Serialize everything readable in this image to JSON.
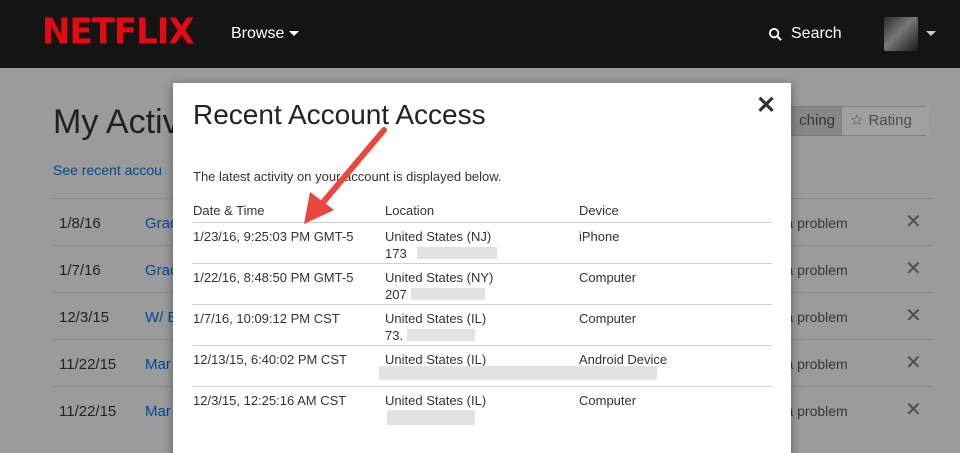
{
  "nav": {
    "logo": "NETFLIX",
    "browse_label": "Browse",
    "search_label": "Search"
  },
  "page": {
    "title": "My Activi",
    "see_recent_link": "See recent accou",
    "tabs": {
      "watching": "ching",
      "rating": "Rating"
    },
    "rows": [
      {
        "date": "1/8/16",
        "title": "Grac",
        "report": "rt a problem"
      },
      {
        "date": "1/7/16",
        "title": "Grac",
        "report": "rt a problem"
      },
      {
        "date": "12/3/15",
        "title": "W/ B",
        "report": "rt a problem"
      },
      {
        "date": "11/22/15",
        "title": "Mar",
        "report": "rt a problem"
      },
      {
        "date": "11/22/15",
        "title": "Mar",
        "report": "rt a problem"
      }
    ]
  },
  "modal": {
    "title": "Recent Account Access",
    "close_glyph": "✕",
    "description": "The latest activity on your account is displayed below.",
    "columns": [
      "Date & Time",
      "Location",
      "Device"
    ],
    "rows": [
      {
        "datetime": "1/23/16, 9:25:03 PM GMT-5",
        "location": "United States (NJ)",
        "ip": "173",
        "device": "iPhone"
      },
      {
        "datetime": "1/22/16, 8:48:50 PM GMT-5",
        "location": "United States (NY)",
        "ip": "207",
        "device": "Computer"
      },
      {
        "datetime": "1/7/16, 10:09:12 PM CST",
        "location": "United States (IL)",
        "ip": "73.",
        "device": "Computer"
      },
      {
        "datetime": "12/13/15, 6:40:02 PM CST",
        "location": "United States (IL)",
        "ip": "",
        "device": "Android Device"
      },
      {
        "datetime": "12/3/15, 12:25:16 AM CST",
        "location": "United States (IL)",
        "ip": "",
        "device": "Computer"
      }
    ]
  },
  "colors": {
    "brand_red": "#e50914",
    "link_blue": "#0073e6",
    "annotation_arrow": "#e8473d"
  },
  "icons": [
    "search-icon",
    "star-icon",
    "close-icon",
    "chevron-down-icon",
    "remove-icon"
  ]
}
